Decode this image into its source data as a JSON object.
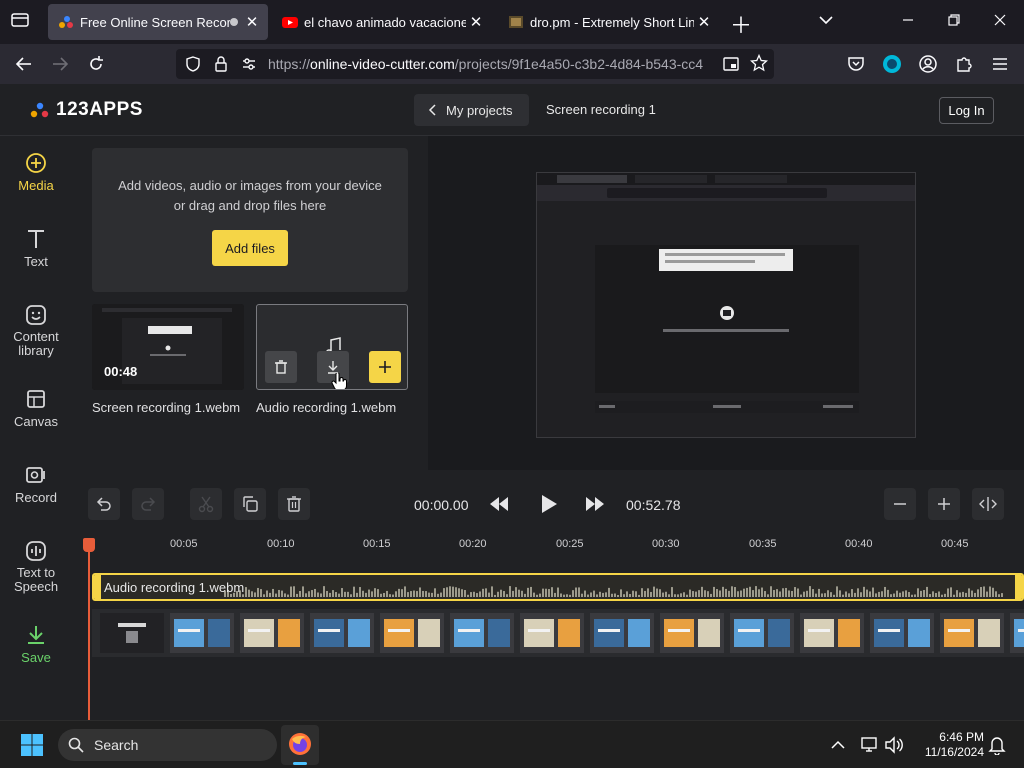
{
  "browser": {
    "tabs": [
      {
        "title": "Free Online Screen Recorder",
        "active": true
      },
      {
        "title": "el chavo animado vacaciones e",
        "active": false
      },
      {
        "title": "dro.pm - Extremely Short Links",
        "active": false
      }
    ],
    "url_prefix": "https://",
    "url_host": "online-video-cutter.com",
    "url_path": "/projects/9f1e4a50-c3b2-4d84-b543-cc4"
  },
  "app": {
    "logo": "123APPS",
    "my_projects": "My projects",
    "project_name": "Screen recording 1",
    "login": "Log In"
  },
  "sidebar": {
    "items": [
      {
        "label": "Media",
        "icon": "plus-circle-icon"
      },
      {
        "label": "Text",
        "icon": "text-icon"
      },
      {
        "label": "Content\nlibrary",
        "icon": "smiley-icon"
      },
      {
        "label": "Canvas",
        "icon": "canvas-icon"
      },
      {
        "label": "Record",
        "icon": "record-icon"
      },
      {
        "label": "Text to\nSpeech",
        "icon": "waveform-icon"
      },
      {
        "label": "Save",
        "icon": "download-icon"
      }
    ]
  },
  "media": {
    "drop_text_1": "Add videos, audio or images from your device",
    "drop_text_2": "or drag and drop files here",
    "add_files": "Add files",
    "files": [
      {
        "name": "Screen recording 1.webm",
        "duration": "00:48"
      },
      {
        "name": "Audio recording 1.webm"
      }
    ]
  },
  "playback": {
    "current_time": "00:00.00",
    "total_time": "00:52.78"
  },
  "timeline": {
    "ticks": [
      "00:05",
      "00:10",
      "00:15",
      "00:20",
      "00:25",
      "00:30",
      "00:35",
      "00:40",
      "00:45"
    ],
    "audio_track_label": "Audio recording 1.webm"
  },
  "taskbar": {
    "search": "Search",
    "time": "6:46 PM",
    "date": "11/16/2024"
  },
  "colors": {
    "accent": "#f5d547",
    "save": "#6ad26a",
    "playhead": "#e85d3a"
  }
}
